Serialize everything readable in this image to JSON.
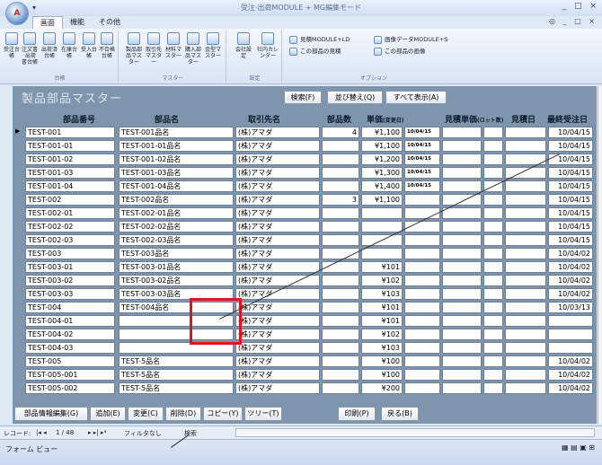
{
  "app": {
    "title": "受注·出荷MODULE + MG編集モード",
    "orb_label": "A",
    "qat": "▾",
    "window_controls": [
      "_",
      "□",
      "×"
    ],
    "help_controls": [
      "◎",
      "_",
      "□",
      "×"
    ]
  },
  "ribbon": {
    "tabs": [
      "画面",
      "機能",
      "その他"
    ],
    "groups": [
      {
        "label": "台帳",
        "buttons": [
          "受注台帳",
          "注文書·出荷書台帳",
          "出荷済台帳",
          "在庫台帳",
          "受入台帳",
          "不合格台帳"
        ]
      },
      {
        "label": "マスター",
        "buttons": [
          "製品部品マスター",
          "取引先マスター",
          "材料マスター",
          "購入部品マスター",
          "金型マスター"
        ]
      },
      {
        "label": "設定",
        "buttons": [
          "会社設定",
          "社内カレンダー"
        ]
      },
      {
        "label": "オプション",
        "buttons": [
          "見積MODULE+LD",
          "この部品の見積",
          "画像データMODULE+S",
          "この部品の画像"
        ]
      }
    ]
  },
  "form": {
    "title": "製品部品マスター",
    "search_button": "検索(F)",
    "sort_button": "並び替え(Q)",
    "show_all_button": "すべて表示(A)",
    "columns": {
      "part_no": "部品番号",
      "part_name": "部品名",
      "customer": "取引先名",
      "count": "部品数",
      "unit_price": "単価",
      "unit_price_note": "(変更日)",
      "quote_price": "見積単価",
      "quote_note": "(ロット数)",
      "quote_date": "見積日",
      "last_order": "最終受注日"
    },
    "rows": [
      {
        "no": "TEST-001",
        "name": "TEST-001品名",
        "cust": "(株)アマダ",
        "count": "4",
        "price": "¥1,100",
        "date": "10/04/15",
        "last": "10/04/15",
        "selected": true
      },
      {
        "no": "TEST-001-01",
        "name": "TEST-001-01品名",
        "cust": "(株)アマダ",
        "count": "",
        "price": "¥1,100",
        "date": "10/04/15",
        "last": "10/04/15"
      },
      {
        "no": "TEST-001-02",
        "name": "TEST-001-02品名",
        "cust": "(株)アマダ",
        "count": "",
        "price": "¥1,200",
        "date": "10/04/15",
        "last": "10/04/15"
      },
      {
        "no": "TEST-001-03",
        "name": "TEST-001-03品名",
        "cust": "(株)アマダ",
        "count": "",
        "price": "¥1,300",
        "date": "10/04/15",
        "last": "10/04/15"
      },
      {
        "no": "TEST-001-04",
        "name": "TEST-001-04品名",
        "cust": "(株)アマダ",
        "count": "",
        "price": "¥1,400",
        "date": "10/04/15",
        "last": "10/04/15"
      },
      {
        "no": "TEST-002",
        "name": "TEST-002品名",
        "cust": "(株)アマダ",
        "count": "3",
        "price": "¥1,100",
        "date": "",
        "last": "10/04/15"
      },
      {
        "no": "TEST-002-01",
        "name": "TEST-002-01品名",
        "cust": "(株)アマダ",
        "count": "",
        "price": "",
        "date": "",
        "last": "10/04/15"
      },
      {
        "no": "TEST-002-02",
        "name": "TEST-002-02品名",
        "cust": "(株)アマダ",
        "count": "",
        "price": "",
        "date": "",
        "last": "10/04/15"
      },
      {
        "no": "TEST-002-03",
        "name": "TEST-002-03品名",
        "cust": "(株)アマダ",
        "count": "",
        "price": "",
        "date": "",
        "last": "10/04/15"
      },
      {
        "no": "TEST-003",
        "name": "TEST-003品名",
        "cust": "(株)アマダ",
        "count": "",
        "price": "",
        "date": "",
        "last": "10/04/02"
      },
      {
        "no": "TEST-003-01",
        "name": "TEST-003-01品名",
        "cust": "(株)アマダ",
        "count": "",
        "price": "¥101",
        "date": "",
        "last": "10/04/02"
      },
      {
        "no": "TEST-003-02",
        "name": "TEST-003-02品名",
        "cust": "(株)アマダ",
        "count": "",
        "price": "¥102",
        "date": "",
        "last": "10/04/02"
      },
      {
        "no": "TEST-003-03",
        "name": "TEST-003-03品名",
        "cust": "(株)アマダ",
        "count": "",
        "price": "¥103",
        "date": "",
        "last": "10/04/02"
      },
      {
        "no": "TEST-004",
        "name": "TEST-004品名",
        "cust": "(株)アマダ",
        "count": "",
        "price": "¥101",
        "date": "",
        "last": "10/03/13"
      },
      {
        "no": "TEST-004-01",
        "name": "",
        "cust": "(株)アマダ",
        "count": "",
        "price": "¥101",
        "date": "",
        "last": ""
      },
      {
        "no": "TEST-004-02",
        "name": "",
        "cust": "(株)アマダ",
        "count": "",
        "price": "¥102",
        "date": "",
        "last": ""
      },
      {
        "no": "TEST-004-03",
        "name": "",
        "cust": "(株)アマダ",
        "count": "",
        "price": "¥103",
        "date": "",
        "last": ""
      },
      {
        "no": "TEST-005",
        "name": "TEST-5品名",
        "cust": "(株)アマダ",
        "count": "",
        "price": "¥100",
        "date": "",
        "last": "10/04/02"
      },
      {
        "no": "TEST-005-001",
        "name": "TEST-5品名",
        "cust": "(株)アマダ",
        "count": "",
        "price": "¥100",
        "date": "",
        "last": "10/04/02"
      },
      {
        "no": "TEST-005-002",
        "name": "TEST-5品名",
        "cust": "(株)アマダ",
        "count": "",
        "price": "¥200",
        "date": "",
        "last": "10/04/02"
      }
    ],
    "bottom_buttons": {
      "edit": "部品情報編集(G)",
      "add": "追加(E)",
      "change": "変更(C)",
      "delete": "削除(D)",
      "copy": "コピー(Y)",
      "tree": "ツリー(T)",
      "print": "印刷(P)",
      "back": "戻る(B)"
    }
  },
  "nav": {
    "record_label": "レコード:",
    "position": "1 / 48",
    "filter": "フィルタなし",
    "search": "検索"
  },
  "status": {
    "text": "フォーム ビュー"
  }
}
